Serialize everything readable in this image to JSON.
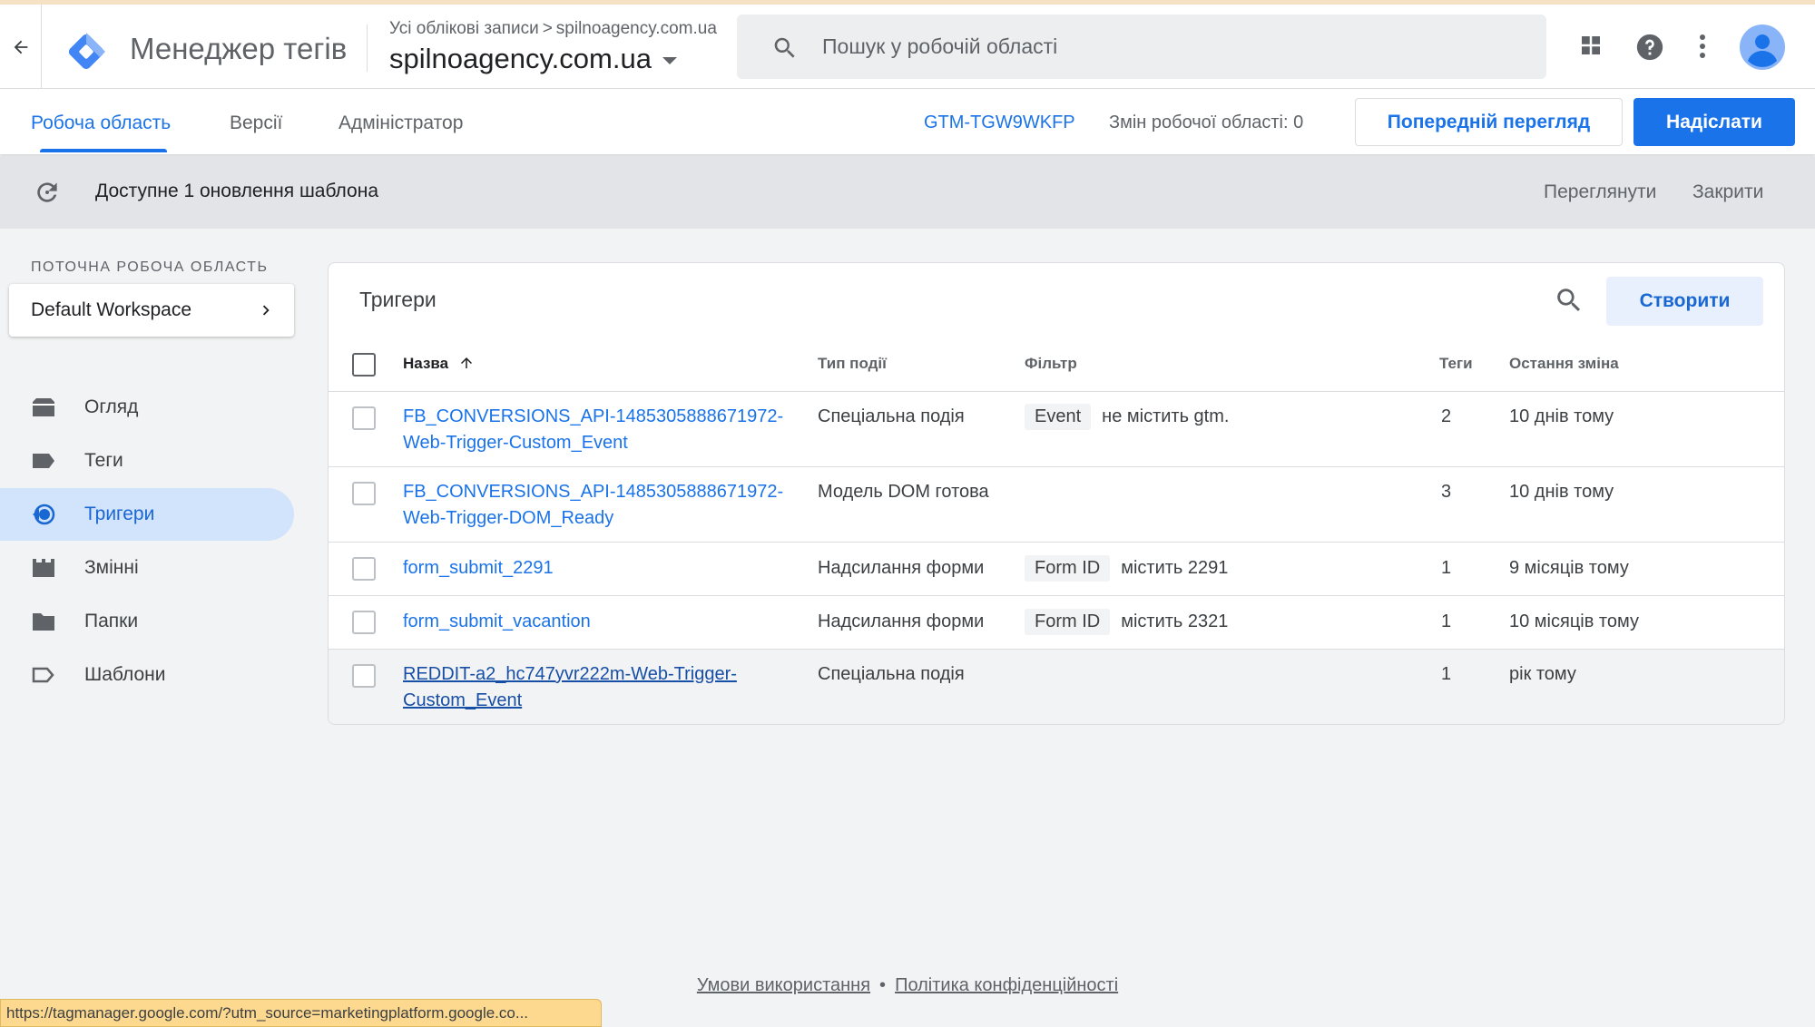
{
  "header": {
    "app_title": "Менеджер тегів",
    "breadcrumb_root": "Усі облікові записи",
    "breadcrumb_account": "spilnoagency.com.ua",
    "container_name": "spilnoagency.com.ua",
    "search_placeholder": "Пошук у робочій області",
    "icons": [
      "back-arrow-icon",
      "gtm-logo",
      "search-icon",
      "apps-grid-icon",
      "help-icon",
      "more-vert-icon",
      "account-avatar-icon"
    ]
  },
  "nav": {
    "tabs": [
      {
        "label": "Робоча область",
        "active": true
      },
      {
        "label": "Версії",
        "active": false
      },
      {
        "label": "Адміністратор",
        "active": false
      }
    ],
    "container_id": "GTM-TGW9WKFP",
    "workspace_changes": "Змін робочої області: 0",
    "preview_label": "Попередній перегляд",
    "submit_label": "Надіслати"
  },
  "banner": {
    "text": "Доступне 1 оновлення шаблона",
    "view_label": "Переглянути",
    "close_label": "Закрити"
  },
  "sidebar": {
    "workspace_label": "ПОТОЧНА РОБОЧА ОБЛАСТЬ",
    "workspace_name": "Default Workspace",
    "items": [
      {
        "label": "Огляд",
        "icon": "overview-icon",
        "active": false
      },
      {
        "label": "Теги",
        "icon": "tag-icon",
        "active": false
      },
      {
        "label": "Тригери",
        "icon": "trigger-icon",
        "active": true
      },
      {
        "label": "Змінні",
        "icon": "variables-icon",
        "active": false
      },
      {
        "label": "Папки",
        "icon": "folder-icon",
        "active": false
      },
      {
        "label": "Шаблони",
        "icon": "templates-icon",
        "active": false
      }
    ]
  },
  "triggers": {
    "title": "Тригери",
    "create_label": "Створити",
    "columns": {
      "name": "Назва",
      "event_type": "Тип події",
      "filter": "Фільтр",
      "tags": "Теги",
      "last_edited": "Остання зміна"
    },
    "rows": [
      {
        "name_line1": "FB_CONVERSIONS_API-1485305888671972-",
        "name_line2": "Web-Trigger-Custom_Event",
        "event_type": "Спеціальна подія",
        "filter_var": "Event",
        "filter_cond": "не містить gtm.",
        "tags": "2",
        "last_edited": "10 днів тому"
      },
      {
        "name_line1": "FB_CONVERSIONS_API-1485305888671972-",
        "name_line2": "Web-Trigger-DOM_Ready",
        "event_type": "Модель DOM готова",
        "filter_var": "",
        "filter_cond": "",
        "tags": "3",
        "last_edited": "10 днів тому"
      },
      {
        "name_line1": "form_submit_2291",
        "name_line2": "",
        "event_type": "Надсилання форми",
        "filter_var": "Form ID",
        "filter_cond": "містить 2291",
        "tags": "1",
        "last_edited": "9 місяців тому"
      },
      {
        "name_line1": "form_submit_vacantion",
        "name_line2": "",
        "event_type": "Надсилання форми",
        "filter_var": "Form ID",
        "filter_cond": "містить 2321",
        "tags": "1",
        "last_edited": "10 місяців тому"
      },
      {
        "name_line1": "REDDIT-a2_hc747yvr222m-Web-Trigger-",
        "name_line2": "Custom_Event",
        "event_type": "Спеціальна подія",
        "filter_var": "",
        "filter_cond": "",
        "tags": "1",
        "last_edited": "рік тому"
      }
    ]
  },
  "footer": {
    "terms": "Умови використання",
    "separator": "•",
    "privacy": "Політика конфіденційності"
  },
  "status_url": "https://tagmanager.google.com/?utm_source=marketingplatform.google.co...",
  "colors": {
    "accent": "#1a73e8",
    "active_nav_bg": "#d2e3fc",
    "banner_bg": "#e2e4e7",
    "status_bar": "#fdd88f"
  }
}
